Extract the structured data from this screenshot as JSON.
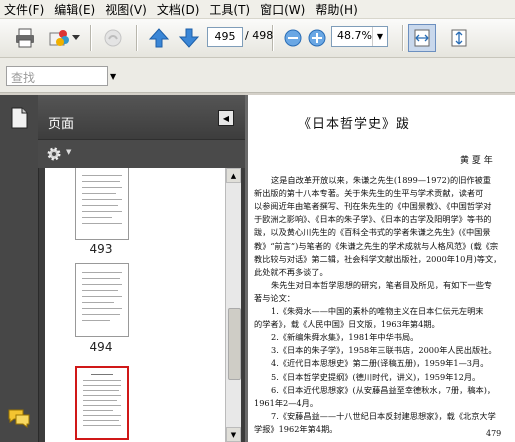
{
  "menu": [
    "文件(F)",
    "编辑(E)",
    "视图(V)",
    "文档(D)",
    "工具(T)",
    "窗口(W)",
    "帮助(H)"
  ],
  "toolbar": {
    "current_page": "495",
    "total_pages": "/ 498",
    "zoom": "48.7%"
  },
  "find": {
    "placeholder": "查找"
  },
  "navpane": {
    "title": "页面",
    "thumbnails": [
      {
        "label": "493"
      },
      {
        "label": "494"
      },
      {
        "label": "495",
        "selected": true
      }
    ]
  },
  "document": {
    "title": "《日本哲学史》跋",
    "author": "黄 夏 年",
    "lines": [
      "这是自改革开放以来，朱谦之先生(1899—1972)的旧作被重",
      "新出版的第十八本专著。关于朱先生的生平与学术贡献，读者可",
      "以参阅近年由笔者撰写、刊在朱先生的《中国景教》、《中国哲学对",
      "于欧洲之影响》、《日本的朱子学》、《日本的古学及阳明学》等书的",
      "跋，以及黄心川先生的《百科全书式的学者朱谦之先生》(《中国景",
      "教》“前言”)与笔者的《朱谦之先生的学术成就与人格风范》(载《宗",
      "教比较与对话》第二辑，社会科学文献出版社，2000年10月)等文，",
      "此处就不再多谈了。",
      "朱先生对日本哲学思想的研究，笔者目及所见，有如下一些专",
      "著与论文：",
      "1.《朱舜水——中国的素朴的唯物主义在日本仁伝元左明末",
      "的学者》，载《人民中国》日文版，1963年第4期。",
      "2.《新编朱舜水集》，1981年中华书局。",
      "3.《日本的朱子学》，1958年三联书店，2000年人民出版社。",
      "4.《近代日本思想史》第二册(译稿五册)，1959年1—3月。",
      "5.《日本哲学史提纲》(德川时代，讲义)，1959年12月。",
      "6.《日本近代思想家》(从安藤昌益至幸德秋水，7册，稿本)，",
      "1961年2—4月。",
      "7.《安藤昌益——十八世纪日本反封建思想家》，载《北京大学",
      "学报》1962年第4期。"
    ],
    "page_number": "479"
  }
}
